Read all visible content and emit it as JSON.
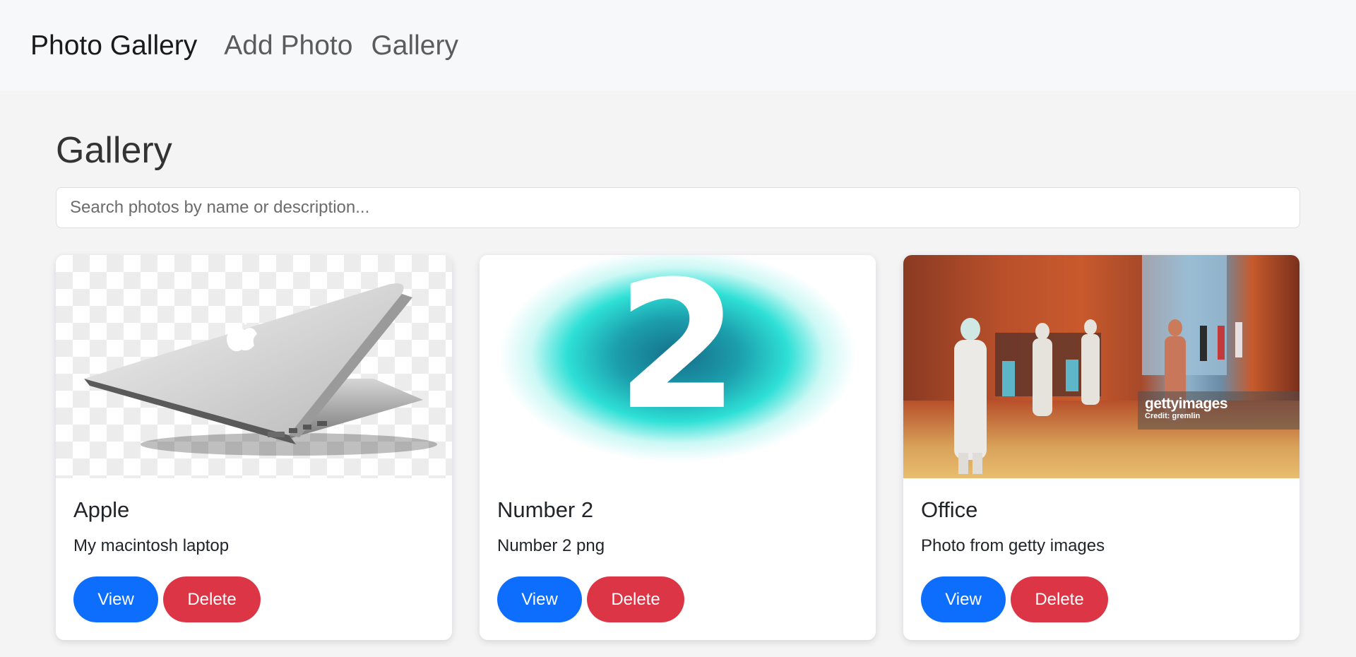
{
  "navbar": {
    "brand": "Photo Gallery",
    "links": [
      "Add Photo",
      "Gallery"
    ]
  },
  "page": {
    "title": "Gallery",
    "search_placeholder": "Search photos by name or description..."
  },
  "photos": [
    {
      "title": "Apple",
      "description": "My macintosh laptop",
      "image": "laptop-photo"
    },
    {
      "title": "Number 2",
      "description": "Number 2 png",
      "image": "number-two-graphic",
      "graphic_text": "2"
    },
    {
      "title": "Office",
      "description": "Photo from getty images",
      "image": "office-corridor-photo",
      "watermark": {
        "logo": "gettyimages",
        "credit": "Credit: gremlin"
      }
    }
  ],
  "buttons": {
    "view": "View",
    "delete": "Delete"
  },
  "colors": {
    "view": "#0d6efd",
    "delete": "#dc3545"
  }
}
